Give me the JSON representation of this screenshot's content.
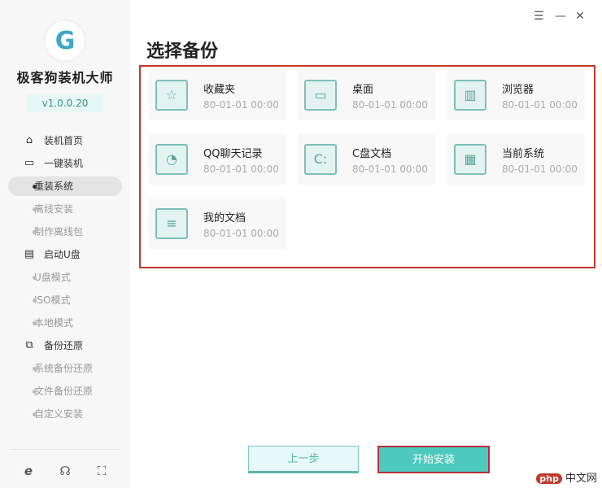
{
  "app": {
    "name": "极客狗装机大师",
    "version": "v1.0.0.20"
  },
  "window": {
    "minimize": "—",
    "menu": "☰",
    "close": "✕"
  },
  "sidebar": {
    "items": [
      {
        "label": "装机首页",
        "type": "top",
        "icon": "home-icon"
      },
      {
        "label": "一键装机",
        "type": "top",
        "icon": "monitor-icon"
      },
      {
        "label": "重装系统",
        "type": "sub",
        "active": true
      },
      {
        "label": "离线安装",
        "type": "sub"
      },
      {
        "label": "制作离线包",
        "type": "sub"
      },
      {
        "label": "启动U盘",
        "type": "top",
        "icon": "usb-icon"
      },
      {
        "label": "U盘模式",
        "type": "sub"
      },
      {
        "label": "ISO模式",
        "type": "sub"
      },
      {
        "label": "本地模式",
        "type": "sub"
      },
      {
        "label": "备份还原",
        "type": "top",
        "icon": "backup-icon"
      },
      {
        "label": "系统备份还原",
        "type": "sub"
      },
      {
        "label": "文件备份还原",
        "type": "sub"
      },
      {
        "label": "自定义安装",
        "type": "sub"
      }
    ]
  },
  "main": {
    "title": "选择备份",
    "items": [
      {
        "name": "收藏夹",
        "time": "80-01-01 00:00",
        "glyph": "☆"
      },
      {
        "name": "桌面",
        "time": "80-01-01 00:00",
        "glyph": "▭"
      },
      {
        "name": "浏览器",
        "time": "80-01-01 00:00",
        "glyph": "▥"
      },
      {
        "name": "QQ聊天记录",
        "time": "80-01-01 00:00",
        "glyph": "◔"
      },
      {
        "name": "C盘文档",
        "time": "80-01-01 00:00",
        "glyph": "C:"
      },
      {
        "name": "当前系统",
        "time": "80-01-01 00:00",
        "glyph": "▦"
      },
      {
        "name": "我的文档",
        "time": "80-01-01 00:00",
        "glyph": "≡"
      }
    ]
  },
  "buttons": {
    "prev": "上一步",
    "start": "开始安装"
  },
  "watermark": {
    "logo": "php",
    "text": "中文网"
  }
}
